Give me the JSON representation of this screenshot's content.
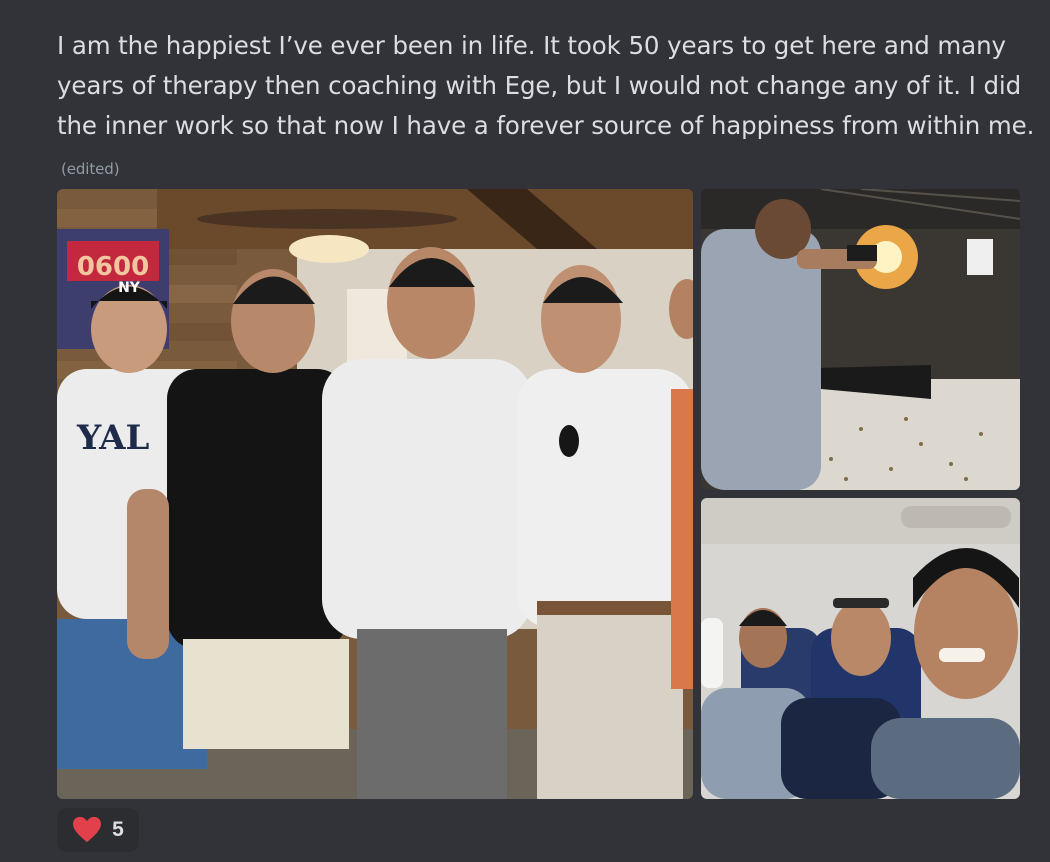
{
  "message": {
    "text": "I am the happiest I’ve ever been in life. It took 50 years to get here and many years of therapy then coaching with Ege, but I would not change any of it. I did the inner work so that now I have a forever source of happiness from within me.",
    "edited_label": "(edited)"
  },
  "attachments": [
    {
      "name": "group-photo",
      "caption_text": "YAL",
      "cap_logo": "NY",
      "sign_text": "0600"
    },
    {
      "name": "shooting-range-photo"
    },
    {
      "name": "airplane-selfie-photo"
    }
  ],
  "reaction": {
    "emoji": "heart-icon",
    "count": "5",
    "color": "#e2414b"
  },
  "colors": {
    "background": "#313338",
    "text": "#dbdee1",
    "muted": "#949ba4"
  }
}
